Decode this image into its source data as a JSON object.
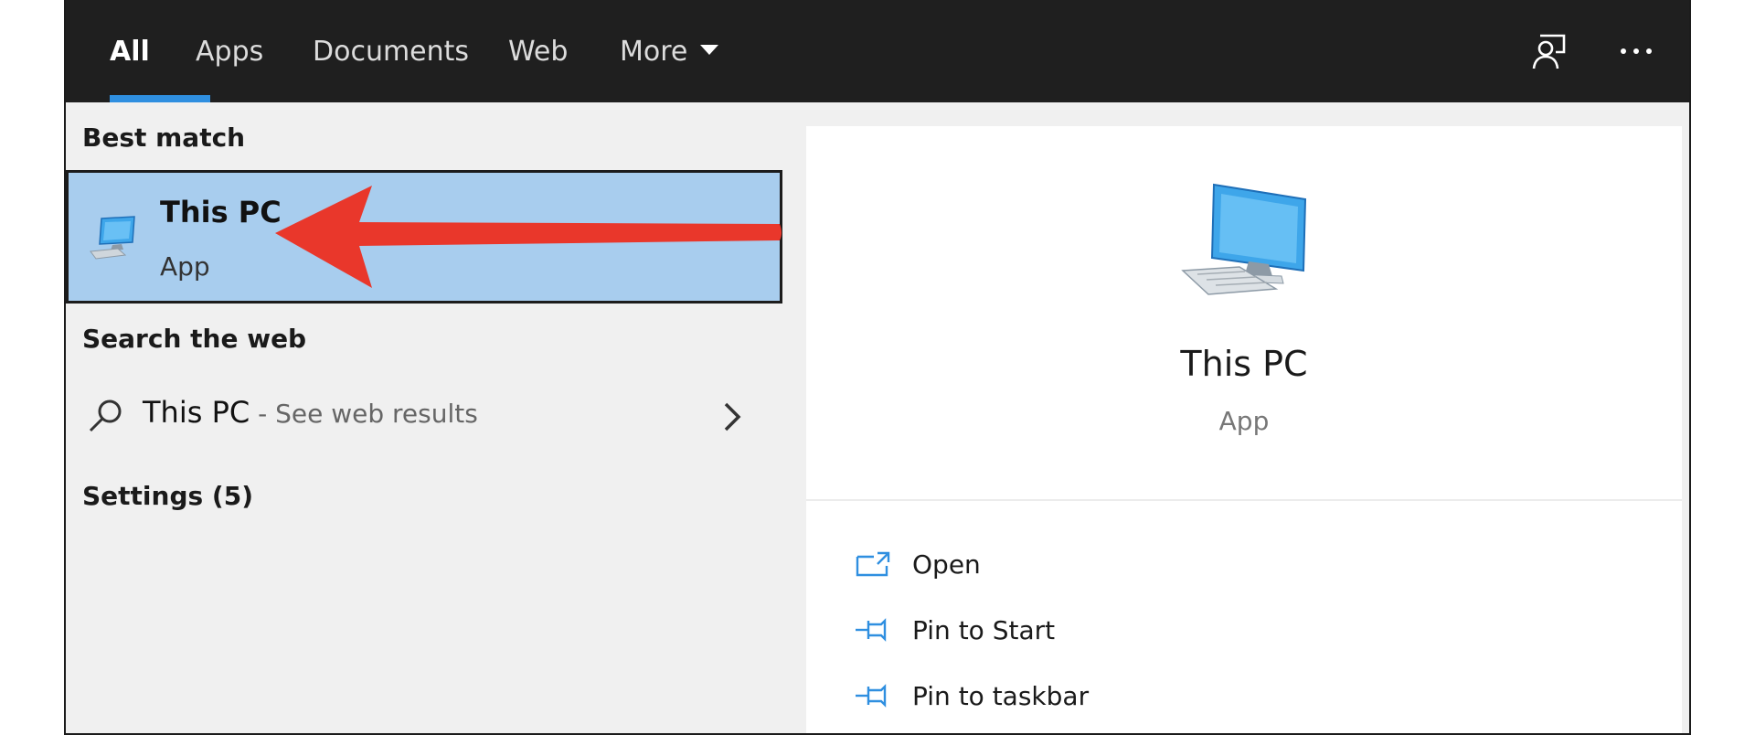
{
  "tabs": [
    {
      "label": "All",
      "active": true
    },
    {
      "label": "Apps"
    },
    {
      "label": "Documents"
    },
    {
      "label": "Web"
    },
    {
      "label": "More"
    }
  ],
  "top_icons": [
    "feedback-icon",
    "more-options-icon"
  ],
  "best_match": {
    "section": "Best match",
    "title": "This PC",
    "subtitle": "App",
    "icon": "computer-icon"
  },
  "search_web": {
    "section": "Search the web",
    "query": "This PC",
    "suffix": " - See web results"
  },
  "settings": {
    "section": "Settings (5)"
  },
  "preview": {
    "title": "This PC",
    "subtitle": "App",
    "actions": [
      {
        "label": "Open",
        "icon": "open-icon"
      },
      {
        "label": "Pin to Start",
        "icon": "pin-icon"
      },
      {
        "label": "Pin to taskbar",
        "icon": "pin-icon"
      }
    ]
  },
  "colors": {
    "accent": "#2f8fe0",
    "topbar": "#1f1f1f",
    "selection": "#a8cdee",
    "annotation_arrow": "#e9372b"
  }
}
